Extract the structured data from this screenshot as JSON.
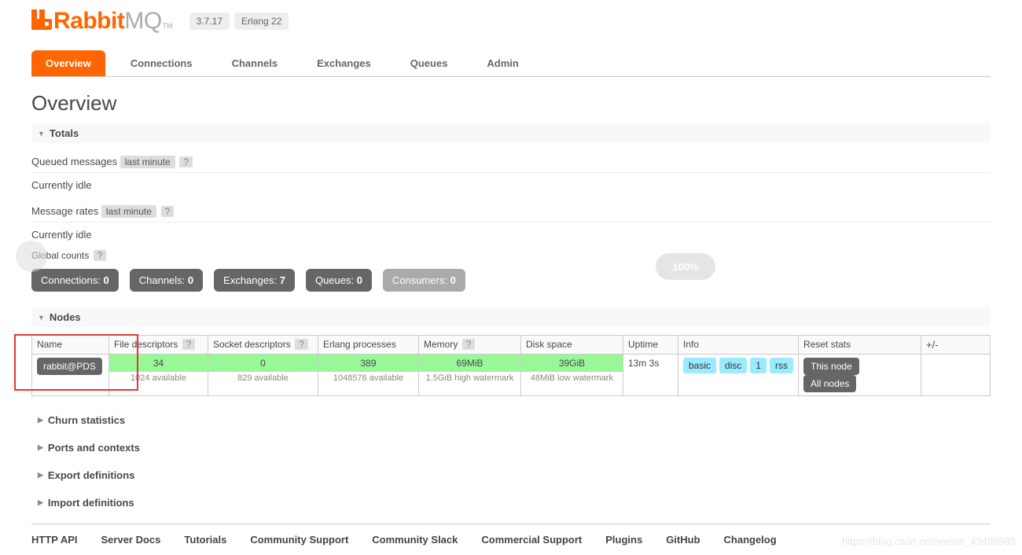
{
  "brand": {
    "part1": "Rabbit",
    "part2": "MQ",
    "tm": "TM"
  },
  "versions": {
    "server": "3.7.17",
    "erlang": "Erlang 22"
  },
  "tabs": [
    {
      "label": "Overview",
      "active": true
    },
    {
      "label": "Connections",
      "active": false
    },
    {
      "label": "Channels",
      "active": false
    },
    {
      "label": "Exchanges",
      "active": false
    },
    {
      "label": "Queues",
      "active": false
    },
    {
      "label": "Admin",
      "active": false
    }
  ],
  "page_title": "Overview",
  "sections": {
    "totals": {
      "title": "Totals",
      "queued_label": "Queued messages",
      "queued_period": "last minute",
      "queued_idle": "Currently idle",
      "rates_label": "Message rates",
      "rates_period": "last minute",
      "rates_idle": "Currently idle",
      "global_label": "Global counts"
    }
  },
  "counts": [
    {
      "label": "Connections:",
      "value": "0",
      "muted": false
    },
    {
      "label": "Channels:",
      "value": "0",
      "muted": false
    },
    {
      "label": "Exchanges:",
      "value": "7",
      "muted": false
    },
    {
      "label": "Queues:",
      "value": "0",
      "muted": false
    },
    {
      "label": "Consumers:",
      "value": "0",
      "muted": true
    }
  ],
  "nodes_section": {
    "title": "Nodes"
  },
  "nodes_columns": {
    "name": "Name",
    "fd": "File descriptors",
    "sd": "Socket descriptors",
    "ep": "Erlang processes",
    "mem": "Memory",
    "disk": "Disk space",
    "uptime": "Uptime",
    "info": "Info",
    "reset": "Reset stats",
    "pm": "+/-"
  },
  "nodes": [
    {
      "name": "rabbit@PDS",
      "fd": "34",
      "fd_sub": "1024 available",
      "sd": "0",
      "sd_sub": "829 available",
      "ep": "389",
      "ep_sub": "1048576 available",
      "mem": "69MiB",
      "mem_sub": "1.5GiB high watermark",
      "disk": "39GiB",
      "disk_sub": "48MiB low watermark",
      "uptime": "13m 3s",
      "info": [
        "basic",
        "disc",
        "1",
        "rss"
      ]
    }
  ],
  "reset_buttons": {
    "this": "This node",
    "all": "All nodes"
  },
  "collapsed_sections": [
    "Churn statistics",
    "Ports and contexts",
    "Export definitions",
    "Import definitions"
  ],
  "footer_links": [
    "HTTP API",
    "Server Docs",
    "Tutorials",
    "Community Support",
    "Community Slack",
    "Commercial Support",
    "Plugins",
    "GitHub",
    "Changelog"
  ],
  "watermark": {
    "url": "https://blog.csdn.net/weixin_43498985",
    "bubble": "100%"
  },
  "colors": {
    "accent": "#f60",
    "metric_green": "#98f898",
    "info_blue": "#99ebff",
    "btn_dark": "#666"
  }
}
